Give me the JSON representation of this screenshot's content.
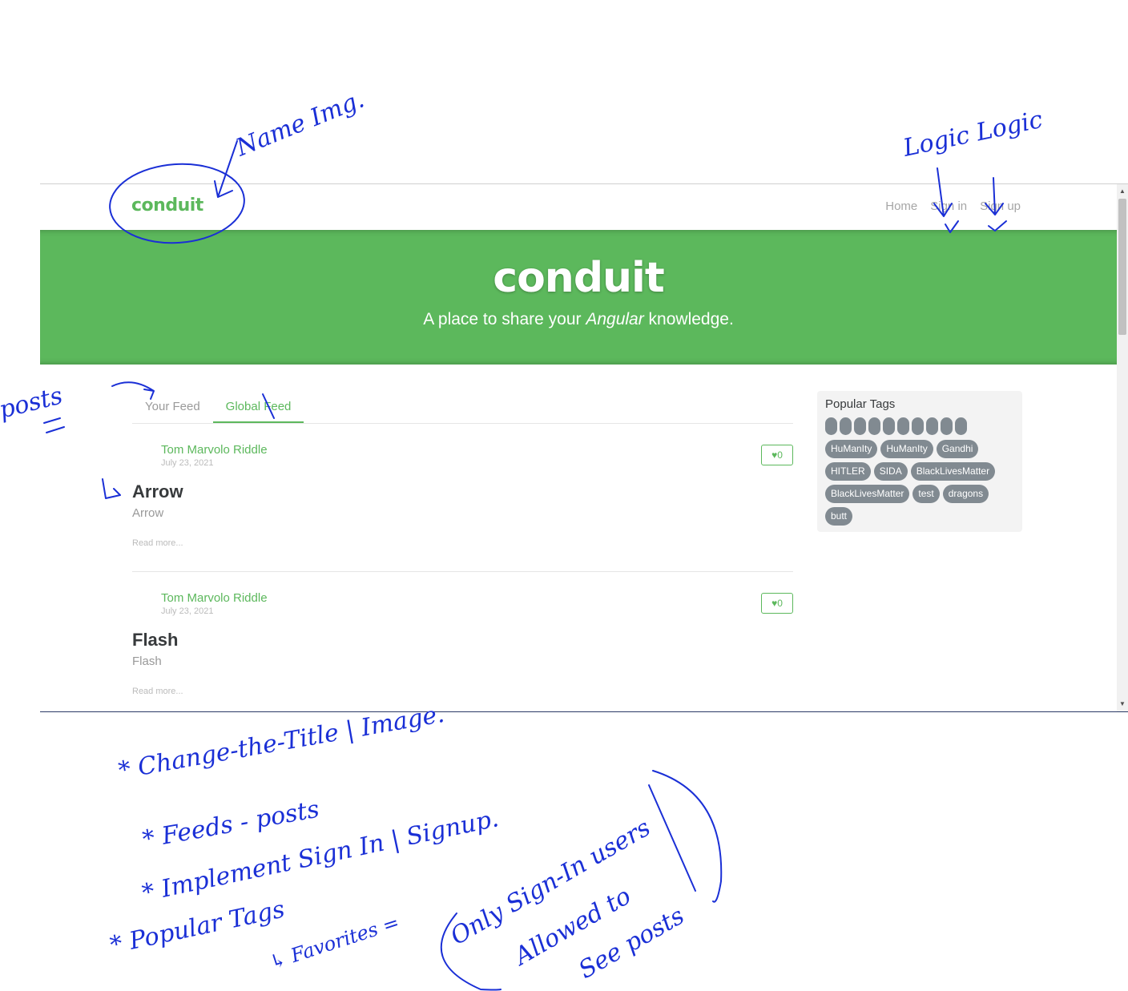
{
  "navbar": {
    "brand": "conduit",
    "links": [
      "Home",
      "Sign in",
      "Sign up"
    ]
  },
  "banner": {
    "title": "conduit",
    "tagline_before": "A place to share your ",
    "tagline_em": "Angular",
    "tagline_after": " knowledge."
  },
  "feed": {
    "tabs": [
      "Your Feed",
      "Global Feed"
    ],
    "active_tab": "Global Feed",
    "articles": [
      {
        "author": "Tom Marvolo Riddle",
        "date": "July 23, 2021",
        "favorites": "0",
        "title": "Arrow",
        "description": "Arrow",
        "read_more": "Read more..."
      },
      {
        "author": "Tom Marvolo Riddle",
        "date": "July 23, 2021",
        "favorites": "0",
        "title": "Flash",
        "description": "Flash",
        "read_more": "Read more..."
      }
    ]
  },
  "sidebar": {
    "title": "Popular Tags",
    "empty_tag_count": 10,
    "tags": [
      "HuManIty",
      "HuManIty",
      "Gandhi",
      "HITLER",
      "SIDA",
      "BlackLivesMatter",
      "BlackLivesMatter",
      "test",
      "dragons",
      "butt"
    ]
  },
  "annotations": {
    "name_img": "Name Img.",
    "logic": "Logic Logic",
    "posts": "posts",
    "notes": [
      "* Change-the-Title | Image.",
      "* Feeds - posts",
      "* Implement Sign In | Signup.",
      "* Popular Tags",
      "↳ Favorites =",
      "Only Sign-In users",
      "Allowed to",
      "See posts"
    ]
  },
  "colors": {
    "accent": "#5cb85c",
    "tag": "#818a91",
    "ink": "#1a2fd6"
  }
}
